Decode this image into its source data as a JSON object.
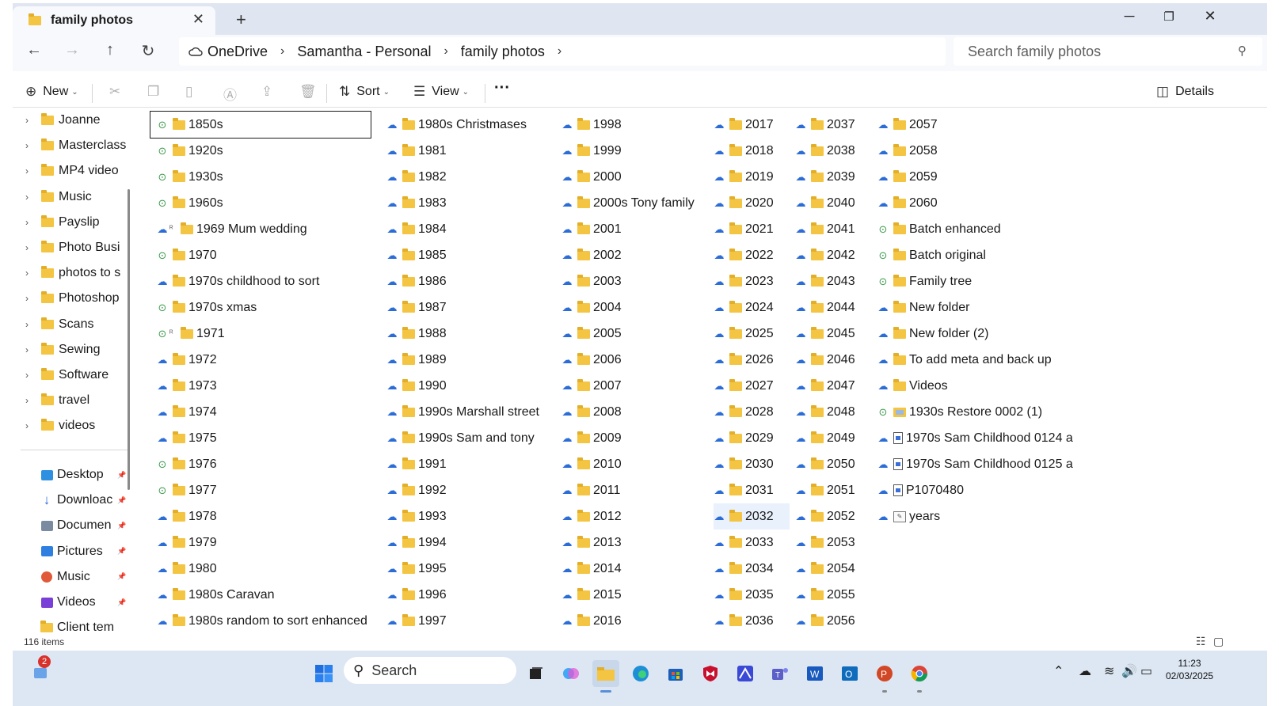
{
  "window": {
    "tab_title": "family photos",
    "tab_close": "✕",
    "new_tab": "+",
    "minimize": "─",
    "restore": "❐",
    "close": "✕"
  },
  "nav": {
    "back": "←",
    "forward": "→",
    "up": "↑",
    "refresh": "↻",
    "breadcrumbs": [
      "OneDrive",
      "Samantha - Personal",
      "family photos"
    ],
    "search_placeholder": "Search family photos"
  },
  "toolbar": {
    "new_label": "New",
    "sort_label": "Sort",
    "view_label": "View",
    "more": "···",
    "details_label": "Details"
  },
  "tree": [
    "Joanne",
    "Masterclass",
    "MP4 video",
    "Music",
    "Payslip",
    "Photo Busi",
    "photos to s",
    "Photoshop",
    "Scans",
    "Sewing",
    "Software",
    "travel",
    "videos"
  ],
  "quick_access": [
    {
      "label": "Desktop",
      "icon": "desktop-icon"
    },
    {
      "label": "Downloac",
      "icon": "download-icon"
    },
    {
      "label": "Documen",
      "icon": "documents-icon"
    },
    {
      "label": "Pictures",
      "icon": "pictures-icon"
    },
    {
      "label": "Music",
      "icon": "music-icon"
    },
    {
      "label": "Videos",
      "icon": "videos-icon"
    },
    {
      "label": "Client templ",
      "icon": "folder-icon"
    }
  ],
  "columns": [
    [
      {
        "name": "1850s",
        "status": "synced",
        "type": "folder"
      },
      {
        "name": "1920s",
        "status": "synced",
        "type": "folder"
      },
      {
        "name": "1930s",
        "status": "synced",
        "type": "folder"
      },
      {
        "name": "1960s",
        "status": "synced",
        "type": "folder"
      },
      {
        "name": "1969 Mum wedding",
        "status": "cloud",
        "type": "folder",
        "shared": true
      },
      {
        "name": "1970",
        "status": "synced",
        "type": "folder"
      },
      {
        "name": "1970s childhood to sort",
        "status": "cloud",
        "type": "folder"
      },
      {
        "name": "1970s xmas",
        "status": "synced",
        "type": "folder"
      },
      {
        "name": "1971",
        "status": "synced",
        "type": "folder",
        "shared": true
      },
      {
        "name": "1972",
        "status": "cloud",
        "type": "folder"
      },
      {
        "name": "1973",
        "status": "cloud",
        "type": "folder"
      },
      {
        "name": "1974",
        "status": "cloud",
        "type": "folder"
      },
      {
        "name": "1975",
        "status": "cloud",
        "type": "folder"
      },
      {
        "name": "1976",
        "status": "synced",
        "type": "folder"
      },
      {
        "name": "1977",
        "status": "synced",
        "type": "folder"
      },
      {
        "name": "1978",
        "status": "cloud",
        "type": "folder"
      },
      {
        "name": "1979",
        "status": "cloud",
        "type": "folder"
      },
      {
        "name": "1980",
        "status": "cloud",
        "type": "folder"
      },
      {
        "name": "1980s Caravan",
        "status": "cloud",
        "type": "folder"
      },
      {
        "name": "1980s random to sort enhanced",
        "status": "cloud",
        "type": "folder"
      }
    ],
    [
      {
        "name": "1980s Christmases",
        "status": "cloud",
        "type": "folder"
      },
      {
        "name": "1981",
        "status": "cloud",
        "type": "folder"
      },
      {
        "name": "1982",
        "status": "cloud",
        "type": "folder"
      },
      {
        "name": "1983",
        "status": "cloud",
        "type": "folder"
      },
      {
        "name": "1984",
        "status": "cloud",
        "type": "folder"
      },
      {
        "name": "1985",
        "status": "cloud",
        "type": "folder"
      },
      {
        "name": "1986",
        "status": "cloud",
        "type": "folder"
      },
      {
        "name": "1987",
        "status": "cloud",
        "type": "folder"
      },
      {
        "name": "1988",
        "status": "cloud",
        "type": "folder"
      },
      {
        "name": "1989",
        "status": "cloud",
        "type": "folder"
      },
      {
        "name": "1990",
        "status": "cloud",
        "type": "folder"
      },
      {
        "name": "1990s Marshall street",
        "status": "cloud",
        "type": "folder"
      },
      {
        "name": "1990s Sam and tony",
        "status": "cloud",
        "type": "folder"
      },
      {
        "name": "1991",
        "status": "cloud",
        "type": "folder"
      },
      {
        "name": "1992",
        "status": "cloud",
        "type": "folder"
      },
      {
        "name": "1993",
        "status": "cloud",
        "type": "folder"
      },
      {
        "name": "1994",
        "status": "cloud",
        "type": "folder"
      },
      {
        "name": "1995",
        "status": "cloud",
        "type": "folder"
      },
      {
        "name": "1996",
        "status": "cloud",
        "type": "folder"
      },
      {
        "name": "1997",
        "status": "cloud",
        "type": "folder"
      }
    ],
    [
      {
        "name": "1998",
        "status": "cloud",
        "type": "folder"
      },
      {
        "name": "1999",
        "status": "cloud",
        "type": "folder"
      },
      {
        "name": "2000",
        "status": "cloud",
        "type": "folder"
      },
      {
        "name": "2000s Tony family",
        "status": "cloud",
        "type": "folder"
      },
      {
        "name": "2001",
        "status": "cloud",
        "type": "folder"
      },
      {
        "name": "2002",
        "status": "cloud",
        "type": "folder"
      },
      {
        "name": "2003",
        "status": "cloud",
        "type": "folder"
      },
      {
        "name": "2004",
        "status": "cloud",
        "type": "folder"
      },
      {
        "name": "2005",
        "status": "cloud",
        "type": "folder"
      },
      {
        "name": "2006",
        "status": "cloud",
        "type": "folder"
      },
      {
        "name": "2007",
        "status": "cloud",
        "type": "folder"
      },
      {
        "name": "2008",
        "status": "cloud",
        "type": "folder"
      },
      {
        "name": "2009",
        "status": "cloud",
        "type": "folder"
      },
      {
        "name": "2010",
        "status": "cloud",
        "type": "folder"
      },
      {
        "name": "2011",
        "status": "cloud",
        "type": "folder"
      },
      {
        "name": "2012",
        "status": "cloud",
        "type": "folder"
      },
      {
        "name": "2013",
        "status": "cloud",
        "type": "folder"
      },
      {
        "name": "2014",
        "status": "cloud",
        "type": "folder"
      },
      {
        "name": "2015",
        "status": "cloud",
        "type": "folder"
      },
      {
        "name": "2016",
        "status": "cloud",
        "type": "folder"
      }
    ],
    [
      {
        "name": "2017",
        "status": "cloud",
        "type": "folder"
      },
      {
        "name": "2018",
        "status": "cloud",
        "type": "folder"
      },
      {
        "name": "2019",
        "status": "cloud",
        "type": "folder"
      },
      {
        "name": "2020",
        "status": "cloud",
        "type": "folder"
      },
      {
        "name": "2021",
        "status": "cloud",
        "type": "folder"
      },
      {
        "name": "2022",
        "status": "cloud",
        "type": "folder"
      },
      {
        "name": "2023",
        "status": "cloud",
        "type": "folder"
      },
      {
        "name": "2024",
        "status": "cloud",
        "type": "folder"
      },
      {
        "name": "2025",
        "status": "cloud",
        "type": "folder"
      },
      {
        "name": "2026",
        "status": "cloud",
        "type": "folder"
      },
      {
        "name": "2027",
        "status": "cloud",
        "type": "folder"
      },
      {
        "name": "2028",
        "status": "cloud",
        "type": "folder"
      },
      {
        "name": "2029",
        "status": "cloud",
        "type": "folder"
      },
      {
        "name": "2030",
        "status": "cloud",
        "type": "folder"
      },
      {
        "name": "2031",
        "status": "cloud",
        "type": "folder"
      },
      {
        "name": "2032",
        "status": "cloud",
        "type": "folder",
        "hover": true
      },
      {
        "name": "2033",
        "status": "cloud",
        "type": "folder"
      },
      {
        "name": "2034",
        "status": "cloud",
        "type": "folder"
      },
      {
        "name": "2035",
        "status": "cloud",
        "type": "folder"
      },
      {
        "name": "2036",
        "status": "cloud",
        "type": "folder"
      }
    ],
    [
      {
        "name": "2037",
        "status": "cloud",
        "type": "folder"
      },
      {
        "name": "2038",
        "status": "cloud",
        "type": "folder"
      },
      {
        "name": "2039",
        "status": "cloud",
        "type": "folder"
      },
      {
        "name": "2040",
        "status": "cloud",
        "type": "folder"
      },
      {
        "name": "2041",
        "status": "cloud",
        "type": "folder"
      },
      {
        "name": "2042",
        "status": "cloud",
        "type": "folder"
      },
      {
        "name": "2043",
        "status": "cloud",
        "type": "folder"
      },
      {
        "name": "2044",
        "status": "cloud",
        "type": "folder"
      },
      {
        "name": "2045",
        "status": "cloud",
        "type": "folder"
      },
      {
        "name": "2046",
        "status": "cloud",
        "type": "folder"
      },
      {
        "name": "2047",
        "status": "cloud",
        "type": "folder"
      },
      {
        "name": "2048",
        "status": "cloud",
        "type": "folder"
      },
      {
        "name": "2049",
        "status": "cloud",
        "type": "folder"
      },
      {
        "name": "2050",
        "status": "cloud",
        "type": "folder"
      },
      {
        "name": "2051",
        "status": "cloud",
        "type": "folder"
      },
      {
        "name": "2052",
        "status": "cloud",
        "type": "folder"
      },
      {
        "name": "2053",
        "status": "cloud",
        "type": "folder"
      },
      {
        "name": "2054",
        "status": "cloud",
        "type": "folder"
      },
      {
        "name": "2055",
        "status": "cloud",
        "type": "folder"
      },
      {
        "name": "2056",
        "status": "cloud",
        "type": "folder"
      }
    ],
    [
      {
        "name": "2057",
        "status": "cloud",
        "type": "folder"
      },
      {
        "name": "2058",
        "status": "cloud",
        "type": "folder"
      },
      {
        "name": "2059",
        "status": "cloud",
        "type": "folder"
      },
      {
        "name": "2060",
        "status": "cloud",
        "type": "folder"
      },
      {
        "name": "Batch enhanced",
        "status": "synced",
        "type": "folder"
      },
      {
        "name": "Batch original",
        "status": "synced",
        "type": "folder"
      },
      {
        "name": "Family tree",
        "status": "synced",
        "type": "folder"
      },
      {
        "name": "New folder",
        "status": "cloud",
        "type": "folder"
      },
      {
        "name": "New folder (2)",
        "status": "cloud",
        "type": "folder"
      },
      {
        "name": "To add meta and back up",
        "status": "cloud",
        "type": "folder"
      },
      {
        "name": "Videos",
        "status": "cloud",
        "type": "folder"
      },
      {
        "name": "1930s Restore 0002 (1)",
        "status": "synced",
        "type": "photo-folder"
      },
      {
        "name": "1970s Sam Childhood 0124 a",
        "status": "cloud",
        "type": "doc"
      },
      {
        "name": "1970s Sam Childhood 0125 a",
        "status": "cloud",
        "type": "doc"
      },
      {
        "name": "P1070480",
        "status": "cloud",
        "type": "doc"
      },
      {
        "name": "years",
        "status": "cloud",
        "type": "image"
      }
    ]
  ],
  "status": {
    "item_count": "116 items"
  },
  "taskbar": {
    "search_label": "Search",
    "notification_count": "2",
    "time": "11:23",
    "date": "02/03/2025"
  },
  "colors": {
    "synced": "#3a9a4a",
    "cloud": "#2b6cd6",
    "folder": "#f4c542",
    "accent": "#2b6cd6"
  }
}
